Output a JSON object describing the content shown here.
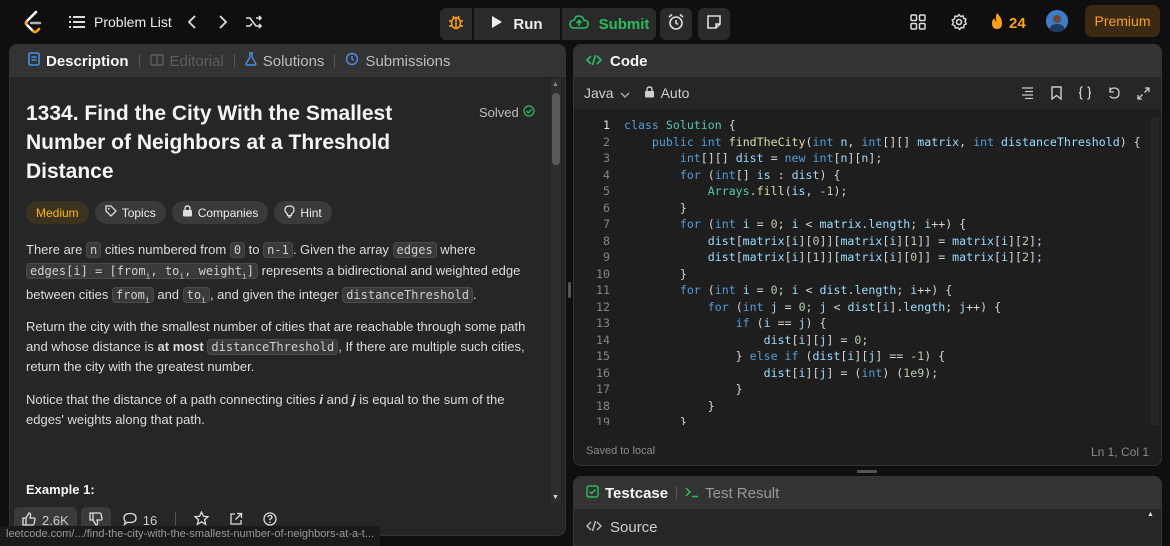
{
  "nav": {
    "problem_list": "Problem List",
    "run": "Run",
    "submit": "Submit",
    "streak": "24",
    "premium": "Premium"
  },
  "left_tabs": [
    "Description",
    "Editorial",
    "Solutions",
    "Submissions"
  ],
  "problem": {
    "title": "1334. Find the City With the Smallest Number of Neighbors at a Threshold Distance",
    "status": "Solved",
    "difficulty": "Medium",
    "tag_topics": "Topics",
    "tag_companies": "Companies",
    "tag_hint": "Hint"
  },
  "description": {
    "p1_a": "There are ",
    "p1_n": "n",
    "p1_b": " cities numbered from ",
    "p1_0": "0",
    "p1_c": " to ",
    "p1_n1": "n-1",
    "p1_d": ". Given the array ",
    "p1_edges": "edges",
    "p1_e": " where ",
    "p1_edges_i": "edges[i] = [from",
    "p1_f": " represents a bidirectional and weighted edge between cities ",
    "p1_from": "from",
    "p1_g": " and ",
    "p1_to": "to",
    "p1_h": ", and given the integer ",
    "p1_dt": "distanceThreshold",
    "p1_i": ".",
    "p2_a": "Return the city with the smallest number of cities that are reachable through some path and whose distance is ",
    "p2_bold": "at most",
    "p2_dt": "distanceThreshold",
    "p2_b": ", If there are multiple such cities, return the city with the greatest number.",
    "p3_a": "Notice that the distance of a path connecting cities ",
    "p3_i": "i",
    "p3_b": " and ",
    "p3_j": "j",
    "p3_c": " is equal to the sum of the edges' weights along that path.",
    "example": "Example 1:"
  },
  "bottom_bar": {
    "likes": "2.6K",
    "comments": "16"
  },
  "url_preview": "leetcode.com/.../find-the-city-with-the-smallest-number-of-neighbors-at-a-t...",
  "code_panel": {
    "title": "Code",
    "language": "Java",
    "mode": "Auto",
    "saved": "Saved to local",
    "cursor": "Ln 1, Col 1",
    "lines": [
      "class Solution {",
      "    public int findTheCity(int n, int[][] matrix, int distanceThreshold) {",
      "        int[][] dist = new int[n][n];",
      "        for (int[] is : dist) {",
      "            Arrays.fill(is, -1);",
      "        }",
      "        for (int i = 0; i < matrix.length; i++) {",
      "            dist[matrix[i][0]][matrix[i][1]] = matrix[i][2];",
      "            dist[matrix[i][1]][matrix[i][0]] = matrix[i][2];",
      "        }",
      "        for (int i = 0; i < dist.length; i++) {",
      "            for (int j = 0; j < dist[i].length; j++) {",
      "                if (i == j) {",
      "                    dist[i][j] = 0;",
      "                } else if (dist[i][j] == -1) {",
      "                    dist[i][j] = (int) (1e9);",
      "                }",
      "            }",
      "        }"
    ]
  },
  "test_panel": {
    "tab_testcase": "Testcase",
    "tab_result": "Test Result",
    "source": "Source"
  },
  "colors": {
    "accent": "#ffa116",
    "submit_green": "#2cbb5d",
    "medium_yellow": "#ffb800",
    "panel_bg": "#262626",
    "tab_bg": "#333333"
  }
}
